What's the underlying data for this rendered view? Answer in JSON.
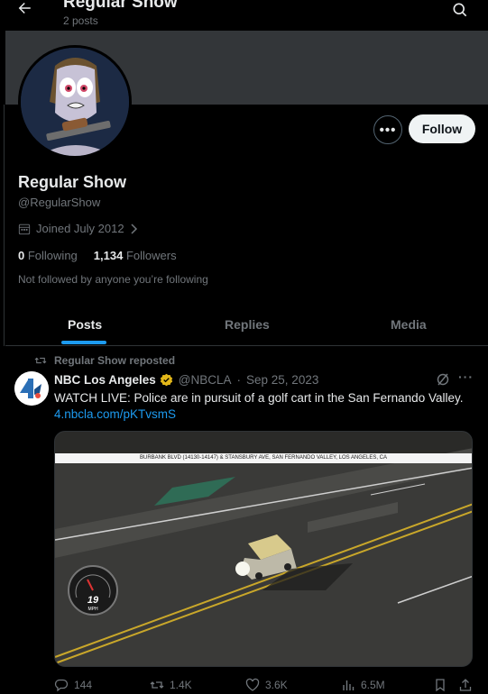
{
  "header": {
    "title": "Regular Show",
    "subtitle": "2 posts"
  },
  "profile": {
    "name": "Regular Show",
    "handle": "@RegularShow",
    "joined": "Joined July 2012",
    "following_count": "0",
    "following_label": "Following",
    "followers_count": "1,134",
    "followers_label": "Followers",
    "not_followed": "Not followed by anyone you’re following",
    "follow_label": "Follow",
    "more_label": "•••"
  },
  "tabs": [
    {
      "label": "Posts",
      "active": true
    },
    {
      "label": "Replies",
      "active": false
    },
    {
      "label": "Media",
      "active": false
    }
  ],
  "post": {
    "repost_text": "Regular Show reposted",
    "author_name": "NBC Los Angeles",
    "author_handle": "@NBCLA",
    "separator": "·",
    "date": "Sep 25, 2023",
    "text": "WATCH LIVE: Police are in pursuit of a golf cart in the San Fernando Valley.",
    "link": "4.nbcla.com/pKTvsmS",
    "video_caption": "BURBANK BLVD (14130-14147) & STANSBURY AVE, SAN FERNANDO VALLEY, LOS ANGELES, CA",
    "speed_value": "19",
    "speed_unit": "MPH",
    "replies": "144",
    "reposts": "1.4K",
    "likes": "3.6K",
    "views": "6.5M"
  },
  "colors": {
    "accent": "#1d9bf0",
    "verified": "#e2b719",
    "background": "#000000"
  }
}
